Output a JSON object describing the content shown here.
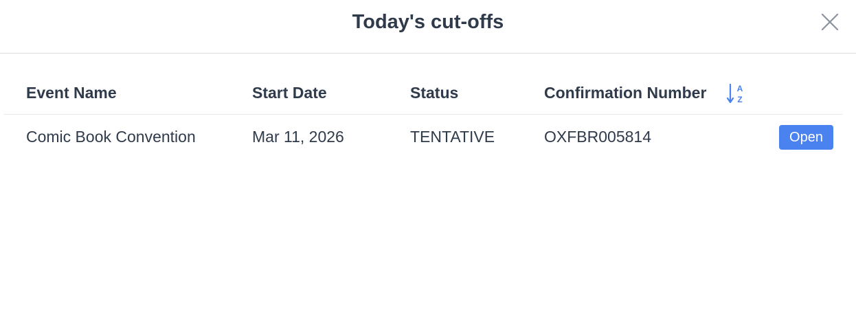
{
  "modal": {
    "title": "Today's cut-offs"
  },
  "table": {
    "columns": [
      "Event Name",
      "Start Date",
      "Status",
      "Confirmation Number"
    ],
    "sort_icon": "sort-alpha-icon",
    "rows": [
      {
        "event_name": "Comic Book Convention",
        "start_date": "Mar 11, 2026",
        "status": "TENTATIVE",
        "confirmation_number": "OXFBR005814",
        "action_label": "Open"
      }
    ]
  },
  "colors": {
    "text": "#2f3a4b",
    "accent": "#4a82f0",
    "divider": "#d9dde2"
  }
}
